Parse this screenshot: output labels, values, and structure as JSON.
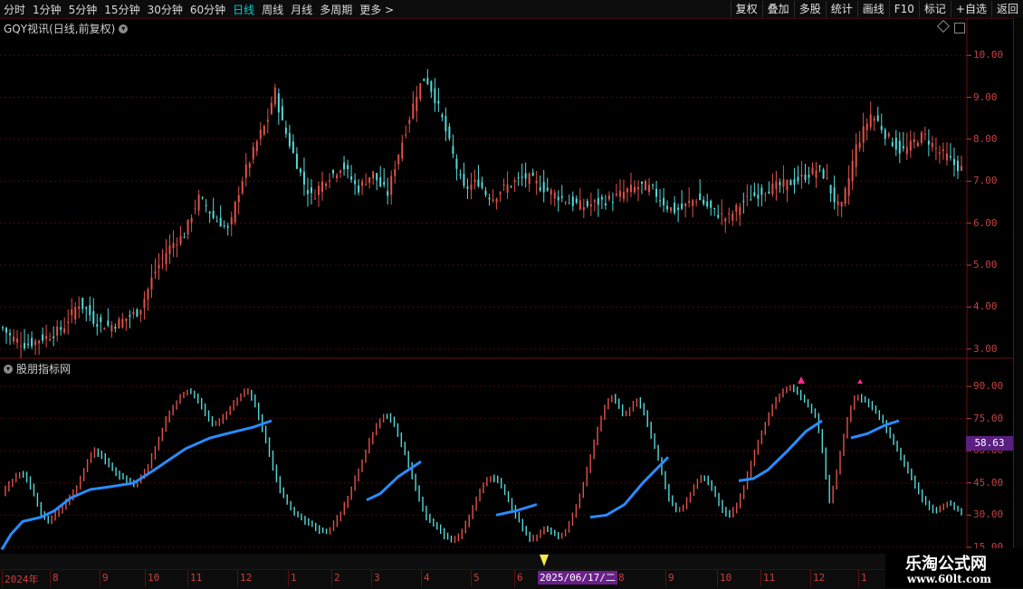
{
  "toolbar": {
    "periods": [
      "分时",
      "1分钟",
      "5分钟",
      "15分钟",
      "30分钟",
      "60分钟",
      "日线",
      "周线",
      "月线",
      "多周期",
      "更多 >"
    ],
    "active_period": "日线",
    "actions": [
      "复权",
      "叠加",
      "多股",
      "统计",
      "画线",
      "F10",
      "标记",
      "+自选",
      "返回"
    ]
  },
  "main_pane": {
    "title": "GQY视讯(日线,前复权)",
    "price_axis": [
      "10.00",
      "9.00",
      "8.00",
      "7.00",
      "6.00",
      "5.00",
      "4.00",
      "3.00"
    ]
  },
  "indicator_pane": {
    "title": "股朋指标网",
    "axis": [
      "90.00",
      "75.00",
      "60.00",
      "45.00",
      "30.00",
      "15.00"
    ],
    "current_value": "58.63"
  },
  "x_axis": {
    "labels": [
      "2024年",
      "8",
      "9",
      "10",
      "11",
      "12",
      "1",
      "2",
      "3",
      "4",
      "5",
      "6",
      "8",
      "9",
      "10",
      "11",
      "12",
      "1"
    ],
    "cursor_date": "2025/06/17/二"
  },
  "watermark": {
    "name": "乐淘公式网",
    "url": "www.60lt.com"
  },
  "colors": {
    "up": "#e0524a",
    "down": "#56d8d8",
    "signal": "#2a8cff",
    "grid": "#5a0e0e",
    "axis_text": "#c84040",
    "active": "#00d0d0"
  },
  "chart_data": [
    {
      "type": "candlestick",
      "title": "GQY视讯(日线,前复权)",
      "ylim": [
        2.8,
        10.5
      ],
      "close_path": [
        3.5,
        3.3,
        3.2,
        3.1,
        3.15,
        3.25,
        3.3,
        3.4,
        3.5,
        3.8,
        4.1,
        3.95,
        3.7,
        3.6,
        3.55,
        3.6,
        3.7,
        3.8,
        3.9,
        4.3,
        4.8,
        5.1,
        5.4,
        5.6,
        5.7,
        6.2,
        6.6,
        6.4,
        6.1,
        6.0,
        5.8,
        6.6,
        7.2,
        7.6,
        8.1,
        8.4,
        9.2,
        8.4,
        7.9,
        7.4,
        6.9,
        6.6,
        6.9,
        7.1,
        7.2,
        7.4,
        7.1,
        6.8,
        7.0,
        7.2,
        6.9,
        6.7,
        7.4,
        8.0,
        8.6,
        9.2,
        9.5,
        9.1,
        8.6,
        8.0,
        7.4,
        6.8,
        6.9,
        7.0,
        6.7,
        6.6,
        6.8,
        6.9,
        7.0,
        7.1,
        7.05,
        6.9,
        6.8,
        6.7,
        6.6,
        6.5,
        6.45,
        6.4,
        6.45,
        6.5,
        6.55,
        6.6,
        6.7,
        6.8,
        6.85,
        6.9,
        6.8,
        6.6,
        6.4,
        6.3,
        6.35,
        6.5,
        6.6,
        6.45,
        6.3,
        6.2,
        6.1,
        6.3,
        6.5,
        6.6,
        6.7,
        6.8,
        6.85,
        6.9,
        6.95,
        7.0,
        7.1,
        7.2,
        7.3,
        7.1,
        6.6,
        6.3,
        7.0,
        7.8,
        8.2,
        8.6,
        8.4,
        8.1,
        7.9,
        7.7,
        7.8,
        8.0,
        8.1,
        7.9,
        7.7,
        7.6,
        7.4,
        7.3
      ]
    },
    {
      "type": "line",
      "title": "股朋指标网",
      "ylim": [
        12,
        93
      ],
      "osc_path": [
        40,
        44,
        48,
        50,
        46,
        38,
        30,
        27,
        30,
        33,
        37,
        41,
        48,
        56,
        60,
        58,
        54,
        50,
        48,
        46,
        44,
        48,
        52,
        60,
        68,
        76,
        81,
        86,
        88,
        86,
        82,
        76,
        72,
        74,
        78,
        82,
        86,
        88,
        84,
        74,
        64,
        52,
        42,
        36,
        31,
        29,
        27,
        25,
        23,
        22,
        25,
        30,
        36,
        44,
        52,
        60,
        68,
        74,
        77,
        74,
        66,
        58,
        48,
        38,
        30,
        26,
        24,
        20,
        18,
        20,
        25,
        32,
        40,
        46,
        48,
        46,
        40,
        34,
        28,
        22,
        18,
        21,
        24,
        22,
        20,
        22,
        28,
        36,
        46,
        58,
        70,
        80,
        86,
        82,
        76,
        80,
        84,
        78,
        68,
        58,
        46,
        36,
        32,
        34,
        40,
        46,
        48,
        44,
        38,
        32,
        30,
        34,
        42,
        52,
        62,
        70,
        78,
        84,
        88,
        90,
        88,
        84,
        80,
        76,
        60,
        36,
        48,
        64,
        78,
        86,
        84,
        82,
        78,
        74,
        68,
        62,
        56,
        50,
        44,
        38,
        34,
        32,
        34,
        36,
        33,
        31
      ]
    }
  ]
}
